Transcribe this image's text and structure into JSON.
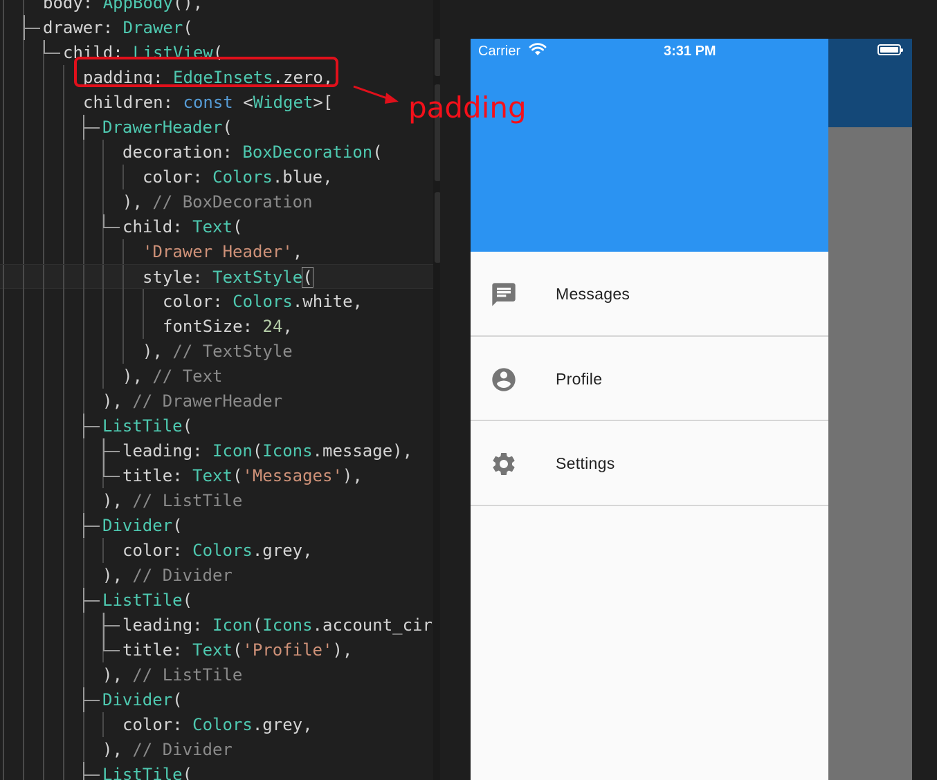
{
  "editor": {
    "lines": [
      [
        [
          "k",
          "body: "
        ],
        [
          "c",
          "AppBody"
        ],
        [
          "k",
          "(),"
        ]
      ],
      [
        [
          "k",
          "drawer: "
        ],
        [
          "c",
          "Drawer"
        ],
        [
          "k",
          "("
        ]
      ],
      [
        [
          "k",
          "child: "
        ],
        [
          "c",
          "ListView"
        ],
        [
          "k",
          "("
        ]
      ],
      [
        [
          "k",
          "padding: "
        ],
        [
          "c",
          "EdgeInsets"
        ],
        [
          "k",
          ".zero,"
        ]
      ],
      [
        [
          "k",
          "children: "
        ],
        [
          "b",
          "const"
        ],
        [
          "k",
          " <"
        ],
        [
          "c",
          "Widget"
        ],
        [
          "k",
          ">["
        ]
      ],
      [
        [
          "c",
          "DrawerHeader"
        ],
        [
          "k",
          "("
        ]
      ],
      [
        [
          "k",
          "decoration: "
        ],
        [
          "c",
          "BoxDecoration"
        ],
        [
          "k",
          "("
        ]
      ],
      [
        [
          "k",
          "color: "
        ],
        [
          "c",
          "Colors"
        ],
        [
          "k",
          ".blue,"
        ]
      ],
      [
        [
          "k",
          "), "
        ],
        [
          "m",
          "// BoxDecoration"
        ]
      ],
      [
        [
          "k",
          "child: "
        ],
        [
          "c",
          "Text"
        ],
        [
          "k",
          "("
        ]
      ],
      [
        [
          "s",
          "'Drawer Header'"
        ],
        [
          "k",
          ","
        ]
      ],
      [
        [
          "k",
          "style: "
        ],
        [
          "c",
          "TextStyle"
        ],
        [
          "k",
          "("
        ]
      ],
      [
        [
          "k",
          "color: "
        ],
        [
          "c",
          "Colors"
        ],
        [
          "k",
          ".white,"
        ]
      ],
      [
        [
          "k",
          "fontSize: "
        ],
        [
          "n",
          "24"
        ],
        [
          "k",
          ","
        ]
      ],
      [
        [
          "k",
          "), "
        ],
        [
          "m",
          "// TextStyle"
        ]
      ],
      [
        [
          "k",
          "), "
        ],
        [
          "m",
          "// Text"
        ]
      ],
      [
        [
          "k",
          "), "
        ],
        [
          "m",
          "// DrawerHeader"
        ]
      ],
      [
        [
          "c",
          "ListTile"
        ],
        [
          "k",
          "("
        ]
      ],
      [
        [
          "k",
          "leading: "
        ],
        [
          "c",
          "Icon"
        ],
        [
          "k",
          "("
        ],
        [
          "c",
          "Icons"
        ],
        [
          "k",
          ".message),"
        ]
      ],
      [
        [
          "k",
          "title: "
        ],
        [
          "c",
          "Text"
        ],
        [
          "k",
          "("
        ],
        [
          "s",
          "'Messages'"
        ],
        [
          "k",
          "),"
        ]
      ],
      [
        [
          "k",
          "), "
        ],
        [
          "m",
          "// ListTile"
        ]
      ],
      [
        [
          "c",
          "Divider"
        ],
        [
          "k",
          "("
        ]
      ],
      [
        [
          "k",
          "color: "
        ],
        [
          "c",
          "Colors"
        ],
        [
          "k",
          ".grey,"
        ]
      ],
      [
        [
          "k",
          "), "
        ],
        [
          "m",
          "// Divider"
        ]
      ],
      [
        [
          "c",
          "ListTile"
        ],
        [
          "k",
          "("
        ]
      ],
      [
        [
          "k",
          "leading: "
        ],
        [
          "c",
          "Icon"
        ],
        [
          "k",
          "("
        ],
        [
          "c",
          "Icons"
        ],
        [
          "k",
          ".account_circ"
        ]
      ],
      [
        [
          "k",
          "title: "
        ],
        [
          "c",
          "Text"
        ],
        [
          "k",
          "("
        ],
        [
          "s",
          "'Profile'"
        ],
        [
          "k",
          "),"
        ]
      ],
      [
        [
          "k",
          "), "
        ],
        [
          "m",
          "// ListTile"
        ]
      ],
      [
        [
          "c",
          "Divider"
        ],
        [
          "k",
          "("
        ]
      ],
      [
        [
          "k",
          "color: "
        ],
        [
          "c",
          "Colors"
        ],
        [
          "k",
          ".grey,"
        ]
      ],
      [
        [
          "k",
          "), "
        ],
        [
          "m",
          "// Divider"
        ]
      ],
      [
        [
          "c",
          "ListTile"
        ],
        [
          "k",
          "("
        ]
      ]
    ]
  },
  "annotation": {
    "text": "padding"
  },
  "simulator": {
    "status_bar": {
      "carrier": "Carrier",
      "time": "3:31 PM"
    },
    "menu_items": [
      {
        "label": "Messages",
        "icon": "message-icon"
      },
      {
        "label": "Profile",
        "icon": "account-circle-icon"
      },
      {
        "label": "Settings",
        "icon": "settings-icon"
      }
    ]
  },
  "colors": {
    "drawer_header": "#2b93f2",
    "app_bar": "#144878",
    "highlight": "#e0101b"
  }
}
